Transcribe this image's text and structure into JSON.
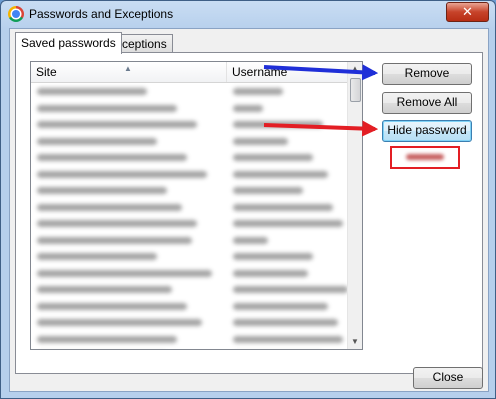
{
  "window": {
    "title": "Passwords and Exceptions",
    "close_glyph": "✕"
  },
  "tabs": [
    {
      "label": "Saved passwords",
      "active": true
    },
    {
      "label": "Exceptions",
      "active": false
    }
  ],
  "list": {
    "columns": {
      "site": "Site",
      "username": "Username"
    },
    "sort_indicator": "▲",
    "row_count": 17,
    "note": "row contents are blurred/obscured in the screenshot"
  },
  "scrollbar": {
    "up_glyph": "▲",
    "down_glyph": "▼"
  },
  "buttons": {
    "remove": "Remove",
    "remove_all": "Remove All",
    "hide_password": "Hide password",
    "close": "Close"
  },
  "annotations": {
    "blue_arrow_color": "#1f2fd8",
    "red_arrow_color": "#e31e24",
    "highlight_box_color": "#e31e24"
  },
  "icons": {
    "app_icon": "chrome-icon"
  }
}
